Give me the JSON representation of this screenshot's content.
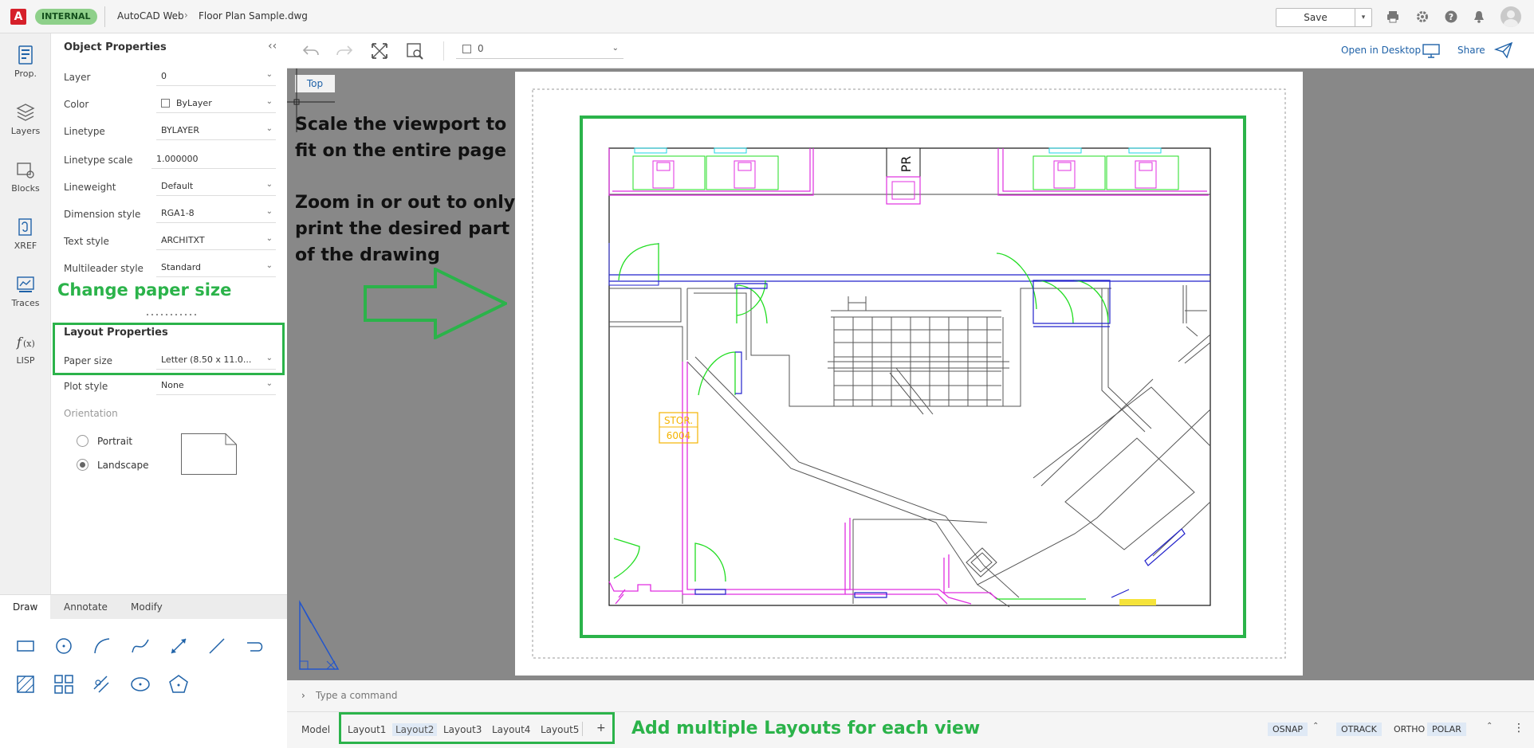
{
  "topbar": {
    "logo": "A",
    "badge": "INTERNAL",
    "app": "AutoCAD Web",
    "separator": "›",
    "file": "Floor Plan Sample.dwg",
    "save": "Save",
    "save_dropdown": "▾",
    "icons": [
      "print-icon",
      "gear-icon",
      "help-icon",
      "bell-icon",
      "avatar"
    ]
  },
  "rail": [
    {
      "label": "Prop.",
      "icon": "properties-icon"
    },
    {
      "label": "Layers",
      "icon": "layers-icon"
    },
    {
      "label": "Blocks",
      "icon": "blocks-icon"
    },
    {
      "label": "XREF",
      "icon": "xref-icon"
    },
    {
      "label": "Traces",
      "icon": "traces-icon"
    },
    {
      "label": "LISP",
      "icon": "lisp-icon"
    }
  ],
  "props": {
    "title": "Object Properties",
    "collapse": "‹‹",
    "rows": [
      {
        "label": "Layer",
        "value": "0"
      },
      {
        "label": "Color",
        "value": "ByLayer"
      },
      {
        "label": "Linetype",
        "value": "BYLAYER"
      },
      {
        "label": "Linetype scale",
        "value": "1.000000"
      },
      {
        "label": "Lineweight",
        "value": "Default"
      },
      {
        "label": "Dimension style",
        "value": "RGA1-8"
      },
      {
        "label": "Text style",
        "value": "ARCHITXT"
      },
      {
        "label": "Multileader style",
        "value": "Standard"
      }
    ],
    "annotation_paper": "Change paper size",
    "layout_title": "Layout Properties",
    "paper_size_label": "Paper size",
    "paper_size_value": "Letter (8.50 x 11.0...",
    "plot_style_label": "Plot style",
    "plot_style_value": "None",
    "orientation_label": "Orientation",
    "portrait": "Portrait",
    "landscape": "Landscape",
    "selected_orientation": "Landscape"
  },
  "tools": {
    "tabs": [
      "Draw",
      "Annotate",
      "Modify"
    ],
    "active_tab": "Draw",
    "row1": [
      "rectangle-tool",
      "circle-tool",
      "arc-tool",
      "spline-tool",
      "dimension-tool",
      "line-tool",
      "polyline-tool"
    ],
    "row2": [
      "hatch-tool",
      "array-tool",
      "trim-tool",
      "ellipse-tool",
      "polygon-tool"
    ]
  },
  "cbar": {
    "layer_value": "0",
    "open_desktop": "Open in Desktop",
    "share": "Share"
  },
  "canvas": {
    "view_label": "Top",
    "annot_scale": "Scale the viewport to fit on the entire page",
    "annot_zoom": "Zoom in or out to only print the desired part of the drawing",
    "room_label_1": "STOR.",
    "room_label_2": "6004",
    "partial_label": "PR"
  },
  "cmd": {
    "chevron": "›",
    "placeholder": "Type a command"
  },
  "status": {
    "model": "Model",
    "layouts": [
      "Layout1",
      "Layout2",
      "Layout3",
      "Layout4",
      "Layout5"
    ],
    "active_layout": "Layout2",
    "add": "+",
    "annotation_layouts": "Add multiple Layouts for each view",
    "toggles": [
      {
        "label": "OSNAP",
        "on": true
      },
      {
        "label": "OTRACK",
        "on": true
      },
      {
        "label": "ORTHO",
        "on": false
      },
      {
        "label": "POLAR",
        "on": true
      }
    ],
    "more": "⋮"
  },
  "colors": {
    "annotation_green": "#2bb34a",
    "accent_blue": "#1f62a8",
    "canvas_gray": "#888888",
    "logo_red": "#d6202a"
  }
}
